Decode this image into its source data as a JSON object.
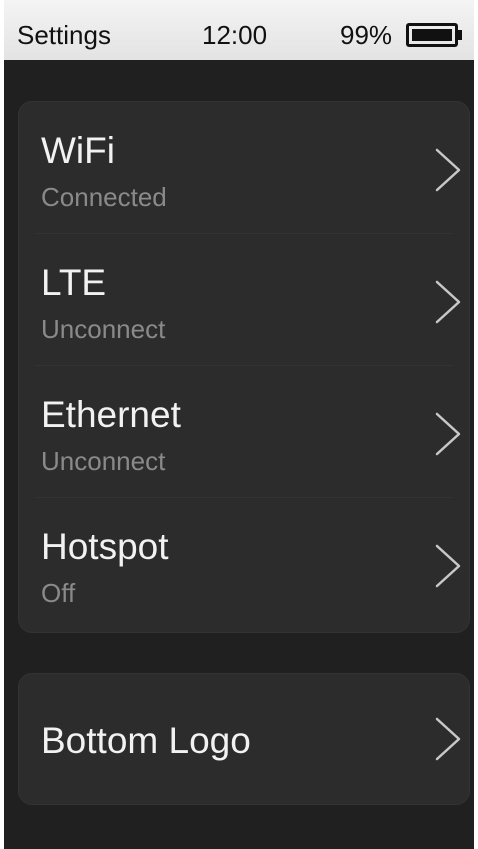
{
  "status_bar": {
    "title": "Settings",
    "time": "12:00",
    "battery_text": "99%",
    "battery_level": 0.99
  },
  "network_items": [
    {
      "title": "WiFi",
      "status": "Connected"
    },
    {
      "title": "LTE",
      "status": "Unconnect"
    },
    {
      "title": "Ethernet",
      "status": "Unconnect"
    },
    {
      "title": "Hotspot",
      "status": "Off"
    }
  ],
  "logo_item": {
    "title": "Bottom Logo"
  },
  "icons": {
    "chevron": "chevron-right-icon",
    "battery": "battery-icon"
  },
  "colors": {
    "background": "#202020",
    "card": "#2c2c2c",
    "status_bar": "#ececec",
    "text_primary": "#f2f2f2",
    "text_secondary": "#8a8a8a"
  }
}
